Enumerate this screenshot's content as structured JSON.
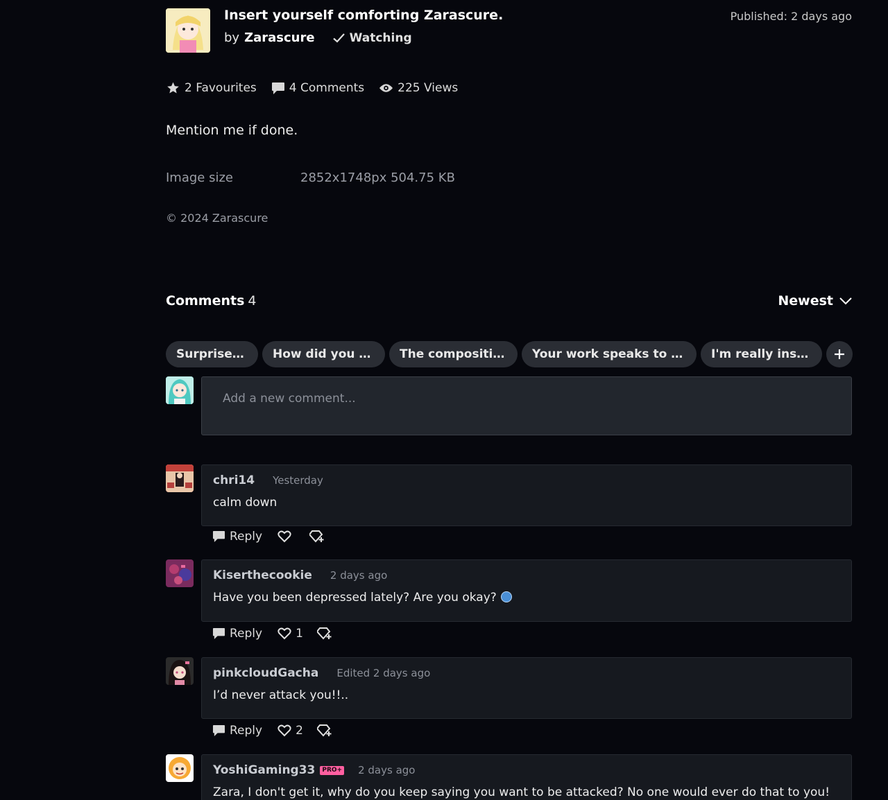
{
  "deviation": {
    "title": "Insert yourself comforting Zarascure.",
    "by_prefix": "by",
    "author": "Zarascure",
    "watch_label": "Watching",
    "published": "Published: 2 days ago",
    "stats": {
      "favourites": "2 Favourites",
      "comments": "4 Comments",
      "views": "225 Views"
    },
    "description": "Mention me if done.",
    "image_size_label": "Image size",
    "image_size_value": "2852x1748px 504.75 KB",
    "copyright": "© 2024 Zarascure"
  },
  "comments_section": {
    "title": "Comments",
    "count": "4",
    "sort_label": "Newest",
    "chips": [
      "Surprise Me!",
      "How did you m…",
      "The composition…",
      "Your work speaks to me …",
      "I'm really inspir…"
    ],
    "new_comment_placeholder": "Add a new comment..."
  },
  "comments": [
    {
      "user": "chri14",
      "time": "Yesterday",
      "text": "calm down",
      "reply": "Reply",
      "likes": "",
      "pro": false
    },
    {
      "user": "Kiserthecookie",
      "time": "2 days ago",
      "text": "Have you been depressed lately? Are you okay?",
      "reply": "Reply",
      "likes": "1",
      "pro": false
    },
    {
      "user": "pinkcloudGacha",
      "time": "Edited 2 days ago",
      "text": "I’d never attack you!!..",
      "reply": "Reply",
      "likes": "2",
      "pro": false
    },
    {
      "user": "YoshiGaming33",
      "time": "2 days ago",
      "text": "Zara, I don't get it, why do you keep saying you want to be attacked? No one would ever do that to you!",
      "reply": "Reply",
      "likes": "",
      "pro": true,
      "badge": "PRO+"
    }
  ],
  "icons": [
    "star-icon",
    "comment-icon",
    "eye-icon",
    "check-icon",
    "chevron-down-icon",
    "plus-icon",
    "reply-icon",
    "heart-icon",
    "badge-icon"
  ]
}
